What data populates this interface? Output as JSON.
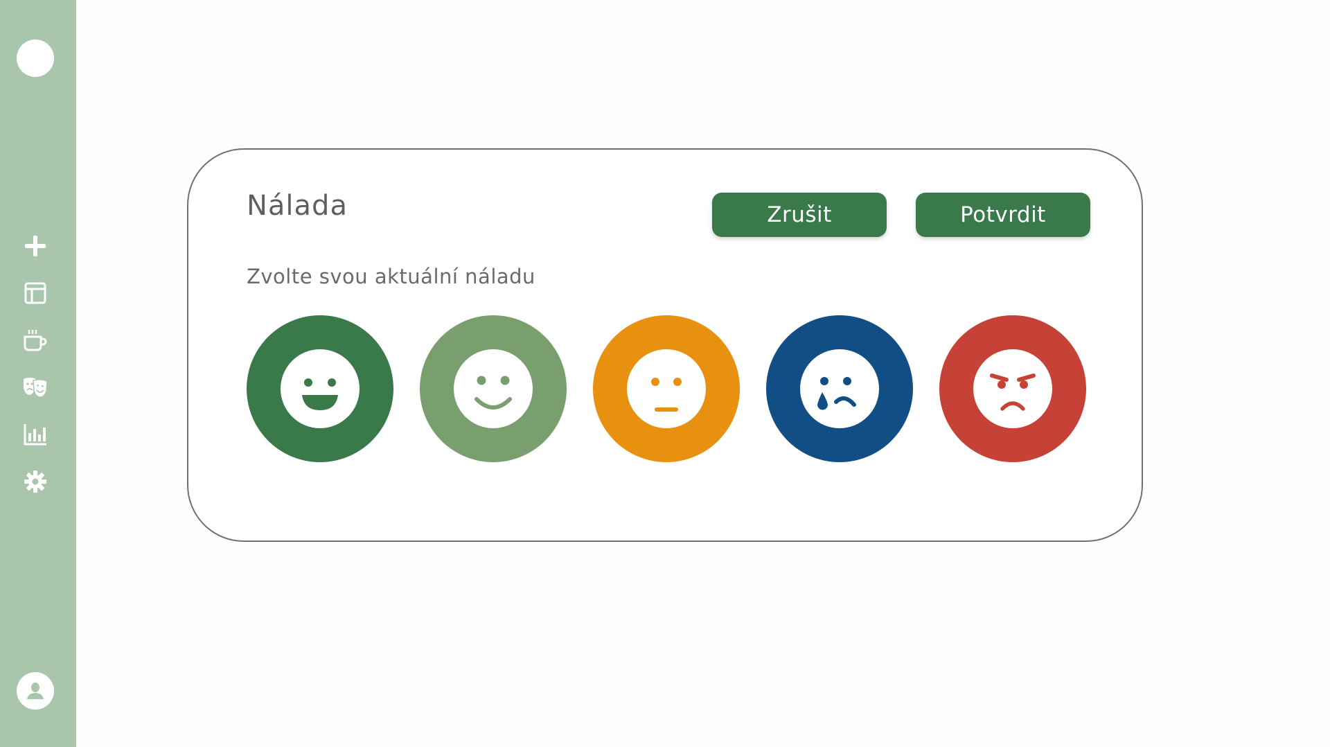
{
  "sidebar": {
    "items": [
      {
        "icon": "plus-icon"
      },
      {
        "icon": "layout-icon"
      },
      {
        "icon": "coffee-cup-icon"
      },
      {
        "icon": "theater-masks-icon"
      },
      {
        "icon": "bar-chart-icon"
      },
      {
        "icon": "gear-icon"
      }
    ],
    "profile_icon": "user-icon"
  },
  "dialog": {
    "title": "Nálada",
    "cancel_label": "Zrušit",
    "confirm_label": "Potvrdit",
    "subtitle": "Zvolte svou aktuální náladu"
  },
  "moods": [
    {
      "icon": "very-happy-face-icon",
      "color": "#39794a"
    },
    {
      "icon": "happy-face-icon",
      "color": "#7a9f6f"
    },
    {
      "icon": "neutral-face-icon",
      "color": "#e8900f"
    },
    {
      "icon": "crying-face-icon",
      "color": "#114e85"
    },
    {
      "icon": "angry-face-icon",
      "color": "#c74236"
    }
  ],
  "colors": {
    "sidebar_bg": "#a9c5ac",
    "accent": "#39794a",
    "card_border": "#6f6f6f"
  }
}
